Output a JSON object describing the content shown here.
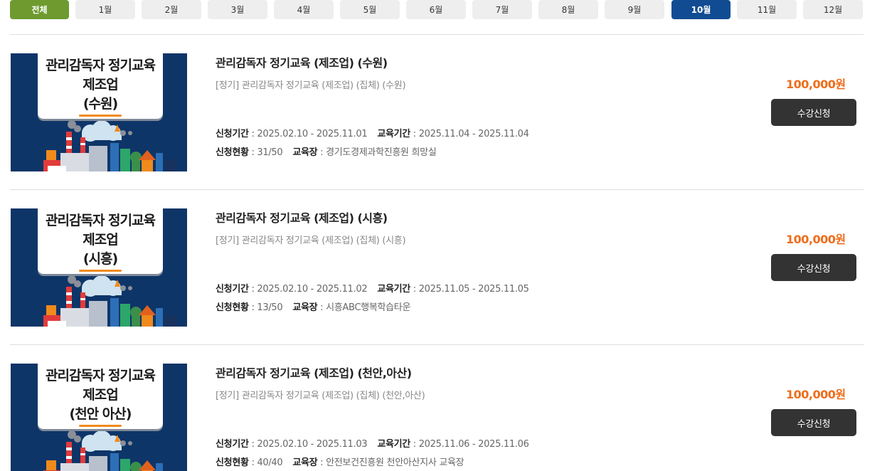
{
  "tabs": {
    "all": "전체",
    "months": [
      "1월",
      "2월",
      "3월",
      "4월",
      "5월",
      "6월",
      "7월",
      "8월",
      "9월",
      "10월",
      "11월",
      "12월"
    ],
    "active": "10월"
  },
  "courses": [
    {
      "thumb": {
        "line1": "관리감독자 정기교육",
        "line2": "제조업",
        "line3": "(수원)"
      },
      "title": "관리감독자 정기교육 (제조업) (수원)",
      "subtitle": "[정기] 관리감독자 정기교육 (제조업) (집체) (수원)",
      "apply_period_label": "신청기간",
      "apply_period": " : 2025.02.10 - 2025.11.01",
      "edu_period_label": "교육기간",
      "edu_period": " : 2025.11.04 - 2025.11.04",
      "status_label": "신청현황",
      "status": " : 31/50",
      "place_label": "교육장",
      "place": " : 경기도경제과학진흥원 희망실",
      "price": "100,000원",
      "button": "수강신청"
    },
    {
      "thumb": {
        "line1": "관리감독자 정기교육",
        "line2": "제조업",
        "line3": "(시흥)"
      },
      "title": "관리감독자 정기교육 (제조업) (시흥)",
      "subtitle": "[정기] 관리감독자 정기교육 (제조업) (집체) (시흥)",
      "apply_period_label": "신청기간",
      "apply_period": " : 2025.02.10 - 2025.11.02",
      "edu_period_label": "교육기간",
      "edu_period": " : 2025.11.05 - 2025.11.05",
      "status_label": "신청현황",
      "status": " : 13/50",
      "place_label": "교육장",
      "place": " : 시흥ABC행복학습타운",
      "price": "100,000원",
      "button": "수강신청"
    },
    {
      "thumb": {
        "line1": "관리감독자 정기교육",
        "line2": "제조업",
        "line3": "(천안 아산)"
      },
      "title": "관리감독자 정기교육 (제조업) (천안,아산)",
      "subtitle": "[정기] 관리감독자 정기교육 (제조업) (집체) (천안,아산)",
      "apply_period_label": "신청기간",
      "apply_period": " : 2025.02.10 - 2025.11.03",
      "edu_period_label": "교육기간",
      "edu_period": " : 2025.11.06 - 2025.11.06",
      "status_label": "신청현황",
      "status": " : 40/40",
      "place_label": "교육장",
      "place": " : 안전보건진흥원 천안아산지사 교육장",
      "price": "100,000원",
      "button": "수강신청"
    }
  ],
  "colors": {
    "tab_all": "#6e9a2f",
    "tab_active": "#114c93",
    "price": "#ef6c1a",
    "thumb_bg": "#0e3568",
    "button_bg": "#333333"
  }
}
